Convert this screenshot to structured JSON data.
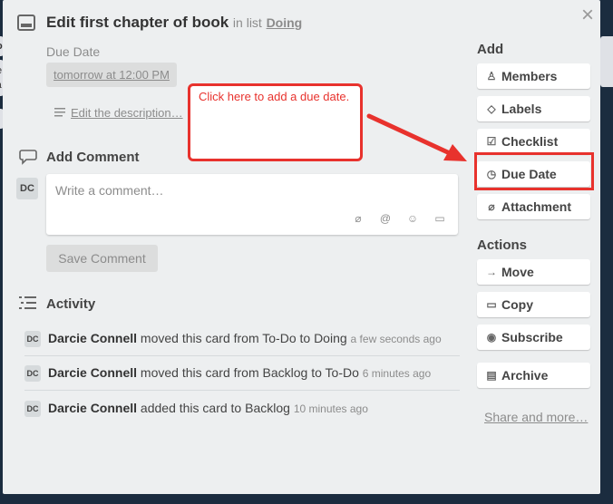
{
  "background": {
    "left_fragments": [
      "o",
      "e",
      "ra",
      "vi"
    ]
  },
  "card": {
    "title": "Edit first chapter of book",
    "in_list_prefix": "in list",
    "list_name": "Doing",
    "due_label": "Due Date",
    "due_value": "tomorrow at 12:00 PM",
    "edit_description": "Edit the description…",
    "close": "×"
  },
  "comment": {
    "heading": "Add Comment",
    "avatar_initials": "DC",
    "placeholder": "Write a comment…",
    "save_label": "Save Comment"
  },
  "activity": {
    "heading": "Activity",
    "items": [
      {
        "initials": "DC",
        "user": "Darcie Connell",
        "action": "moved this card from To-Do to Doing",
        "when": "a few seconds ago"
      },
      {
        "initials": "DC",
        "user": "Darcie Connell",
        "action": "moved this card from Backlog to To-Do",
        "when": "6 minutes ago"
      },
      {
        "initials": "DC",
        "user": "Darcie Connell",
        "action": "added this card to Backlog",
        "when": "10 minutes ago"
      }
    ]
  },
  "sidebar": {
    "add_heading": "Add",
    "add_buttons": [
      {
        "label": "Members",
        "icon": "person-icon"
      },
      {
        "label": "Labels",
        "icon": "tag-icon"
      },
      {
        "label": "Checklist",
        "icon": "checkbox-icon"
      },
      {
        "label": "Due Date",
        "icon": "clock-icon"
      },
      {
        "label": "Attachment",
        "icon": "paperclip-icon"
      }
    ],
    "actions_heading": "Actions",
    "action_buttons": [
      {
        "label": "Move",
        "icon": "arrow-right-icon"
      },
      {
        "label": "Copy",
        "icon": "card-icon"
      },
      {
        "label": "Subscribe",
        "icon": "eye-icon"
      },
      {
        "label": "Archive",
        "icon": "archive-icon"
      }
    ],
    "share_link": "Share and more…"
  },
  "annotation": {
    "callout_text": "Click here to add a due date.",
    "color": "#e8322d"
  }
}
